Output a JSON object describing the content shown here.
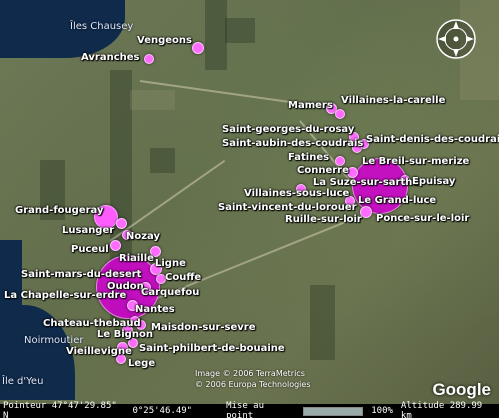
{
  "map": {
    "cities": [
      {
        "id": "vengeons",
        "label": "Vengeons"
      },
      {
        "id": "avranches",
        "label": "Avranches"
      },
      {
        "id": "mamers",
        "label": "Mamers"
      },
      {
        "id": "villaines-la-carelle",
        "label": "Villaines-la-carelle"
      },
      {
        "id": "saint-georges-du-rosay",
        "label": "Saint-georges-du-rosay"
      },
      {
        "id": "saint-aubin-des-coudrais",
        "label": "Saint-aubin-des-coudrais"
      },
      {
        "id": "saint-denis-des-coudrais",
        "label": "Saint-denis-des-coudrais"
      },
      {
        "id": "fatines",
        "label": "Fatines"
      },
      {
        "id": "le-breil-sur-merize",
        "label": "Le Breil-sur-merize"
      },
      {
        "id": "connerre",
        "label": "Connerre"
      },
      {
        "id": "la-suze-sur-sarthe",
        "label": "La Suze-sur-sarthe"
      },
      {
        "id": "epuisay",
        "label": "Epuisay"
      },
      {
        "id": "villaines-sous-luce",
        "label": "Villaines-sous-luce"
      },
      {
        "id": "le-grand-luce",
        "label": "Le Grand-luce"
      },
      {
        "id": "saint-vincent-du-lorouer",
        "label": "Saint-vincent-du-lorouer"
      },
      {
        "id": "ruille-sur-loir",
        "label": "Ruille-sur-loir"
      },
      {
        "id": "ponce-sur-le-loir",
        "label": "Ponce-sur-le-loir"
      },
      {
        "id": "grand-fougeray",
        "label": "Grand-fougeray"
      },
      {
        "id": "lusanger",
        "label": "Lusanger"
      },
      {
        "id": "nozay",
        "label": "Nozay"
      },
      {
        "id": "puceul",
        "label": "Puceul"
      },
      {
        "id": "riaille",
        "label": "Riaille"
      },
      {
        "id": "ligne",
        "label": "Ligne"
      },
      {
        "id": "saint-mars-du-desert",
        "label": "Saint-mars-du-desert"
      },
      {
        "id": "couffe",
        "label": "Couffe"
      },
      {
        "id": "oudon",
        "label": "Oudon"
      },
      {
        "id": "la-chapelle-sur-erdre",
        "label": "La Chapelle-sur-erdre"
      },
      {
        "id": "carquefou",
        "label": "Carquefou"
      },
      {
        "id": "nantes",
        "label": "Nantes"
      },
      {
        "id": "chateau-thebaud",
        "label": "Chateau-thebaud"
      },
      {
        "id": "maisdon-sur-sevre",
        "label": "Maisdon-sur-sevre"
      },
      {
        "id": "le-bignon",
        "label": "Le Bignon"
      },
      {
        "id": "vieillevigne",
        "label": "Vieillevigne"
      },
      {
        "id": "saint-philbert-de-bouaine",
        "label": "Saint-philbert-de-bouaine"
      },
      {
        "id": "lege",
        "label": "Lege"
      }
    ],
    "sea_labels": {
      "iles_chausey": "Îles Chausey",
      "noirmoutier": "Noirmoutier",
      "ile_d_yeu": "Île d'Yeu"
    },
    "copyright": [
      "Image © 2006 TerraMetrics",
      "© 2006 Europa Technologies"
    ],
    "logo": "Google",
    "colors": {
      "marker": "#ff6bff",
      "marker_cluster": "#d400d4"
    }
  },
  "status_bar": {
    "pointer": "Pointeur 47°47'29.85\" N",
    "longitude": "0°25'46.49\"",
    "streaming_label": "Mise au point",
    "streaming_value": "100%",
    "altitude": "Altitude 289.99 km"
  }
}
